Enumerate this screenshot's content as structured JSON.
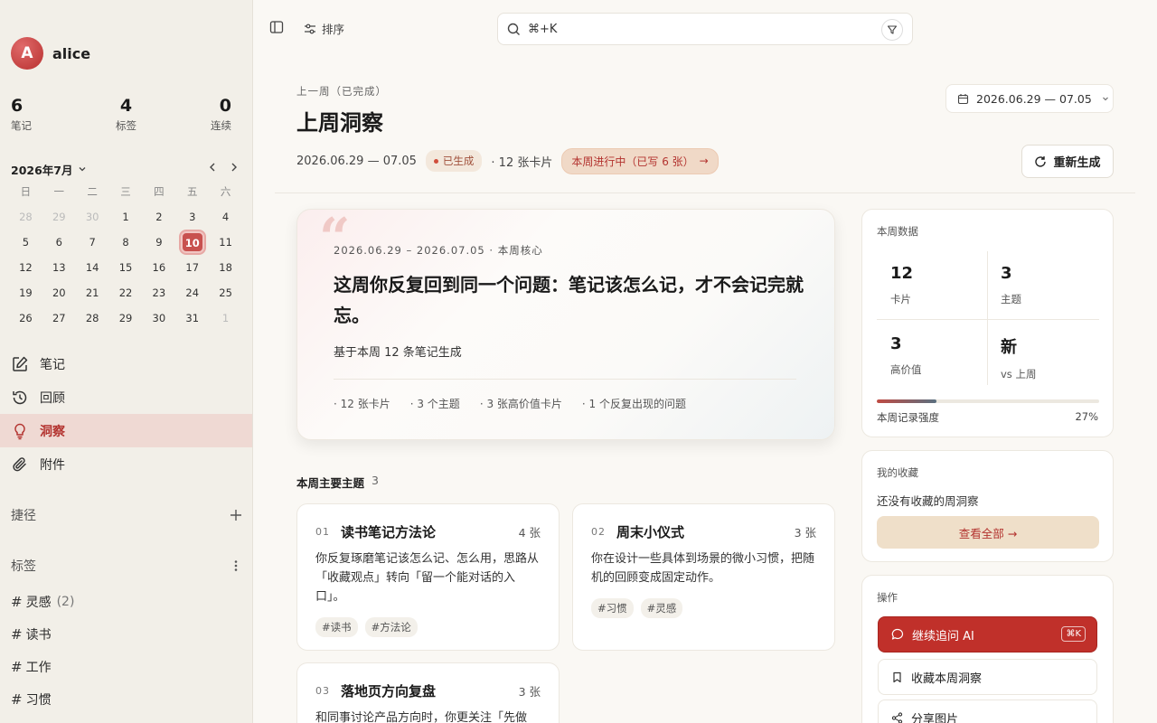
{
  "user": {
    "name": "alice",
    "initial": "A"
  },
  "stats": [
    {
      "value": "6",
      "label": "笔记"
    },
    {
      "value": "4",
      "label": "标签"
    },
    {
      "value": "0",
      "label": "连续"
    }
  ],
  "calendar": {
    "month_label": "2026年7月",
    "weekdays": [
      "日",
      "一",
      "二",
      "三",
      "四",
      "五",
      "六"
    ],
    "weeks": [
      [
        {
          "d": "28",
          "m": true
        },
        {
          "d": "29",
          "m": true
        },
        {
          "d": "30",
          "m": true
        },
        {
          "d": "1"
        },
        {
          "d": "2"
        },
        {
          "d": "3"
        },
        {
          "d": "4"
        }
      ],
      [
        {
          "d": "5"
        },
        {
          "d": "6"
        },
        {
          "d": "7"
        },
        {
          "d": "8"
        },
        {
          "d": "9"
        },
        {
          "d": "10",
          "today": true
        },
        {
          "d": "11"
        }
      ],
      [
        {
          "d": "12"
        },
        {
          "d": "13"
        },
        {
          "d": "14"
        },
        {
          "d": "15"
        },
        {
          "d": "16"
        },
        {
          "d": "17"
        },
        {
          "d": "18"
        }
      ],
      [
        {
          "d": "19"
        },
        {
          "d": "20"
        },
        {
          "d": "21"
        },
        {
          "d": "22"
        },
        {
          "d": "23"
        },
        {
          "d": "24"
        },
        {
          "d": "25"
        }
      ],
      [
        {
          "d": "26"
        },
        {
          "d": "27"
        },
        {
          "d": "28"
        },
        {
          "d": "29"
        },
        {
          "d": "30"
        },
        {
          "d": "31"
        },
        {
          "d": "1",
          "m": true
        }
      ]
    ]
  },
  "nav": [
    {
      "label": "笔记",
      "icon": "edit-icon"
    },
    {
      "label": "回顾",
      "icon": "history-icon"
    },
    {
      "label": "洞察",
      "icon": "lightbulb-icon",
      "active": true
    },
    {
      "label": "附件",
      "icon": "paperclip-icon"
    }
  ],
  "shortcuts": {
    "title": "捷径"
  },
  "tags_section": {
    "title": "标签",
    "items": [
      {
        "name": "灵感",
        "count": "(2)"
      },
      {
        "name": "读书",
        "count": ""
      },
      {
        "name": "工作",
        "count": ""
      },
      {
        "name": "习惯",
        "count": ""
      }
    ]
  },
  "topbar": {
    "sort_label": "排序",
    "search_placeholder": "⌘+K"
  },
  "header": {
    "subtitle": "上一周（已完成）",
    "title": "上周洞察",
    "date_range": "2026.06.29 — 07.05",
    "status_badge": "已生成",
    "card_count": "· 12 张卡片",
    "week_badge": "本周进行中（已写 6 张）",
    "week_badge_arrow": "→",
    "date_picker": "2026.06.29 — 07.05",
    "regen_label": "重新生成"
  },
  "hero": {
    "quote_mark": "“",
    "kicker": "2026.06.29 – 2026.07.05 · 本周核心",
    "title": "这周你反复回到同一个问题：笔记该怎么记，才不会记完就忘。",
    "desc": "基于本周 12 条笔记生成",
    "foot": [
      "· 12 张卡片",
      "· 3 个主题",
      "· 3 张高价值卡片",
      "· 1 个反复出现的问题"
    ]
  },
  "topics": {
    "title": "本周主要主题",
    "count": "3",
    "items": [
      {
        "num": "01",
        "title": "读书笔记方法论",
        "count": "4 张",
        "body": "你反复琢磨笔记该怎么记、怎么用，思路从「收藏观点」转向「留一个能对话的入口」。",
        "tags": [
          "#读书",
          "#方法论"
        ]
      },
      {
        "num": "02",
        "title": "周末小仪式",
        "count": "3 张",
        "body": "你在设计一些具体到场景的微小习惯，把随机的回顾变成固定动作。",
        "tags": [
          "#习惯",
          "#灵感"
        ]
      },
      {
        "num": "03",
        "title": "落地页方向复盘",
        "count": "3 张",
        "body": "和同事讨论产品方向时，你更关注「先做",
        "tags": []
      }
    ]
  },
  "week_stats": {
    "title": "本周数据",
    "kpis": [
      {
        "value": "12",
        "label": "卡片"
      },
      {
        "value": "3",
        "label": "主题"
      },
      {
        "value": "3",
        "label": "高价值"
      },
      {
        "value": "新",
        "label": "vs 上周"
      }
    ],
    "progress_label": "本周记录强度",
    "progress_text": "27%",
    "progress_value": 0.27
  },
  "favorites": {
    "title": "我的收藏",
    "empty_text": "还没有收藏的周洞察",
    "view_all": "查看全部 →"
  },
  "actions": {
    "title": "操作",
    "ask_ai": "继续追问 AI",
    "ask_ai_kbd": "⌘K",
    "favorite": "收藏本周洞察",
    "share": "分享图片"
  },
  "colors": {
    "accent": "#c0302a",
    "sidebar_bg": "#f2efe8",
    "page_bg": "#faf8f4"
  }
}
